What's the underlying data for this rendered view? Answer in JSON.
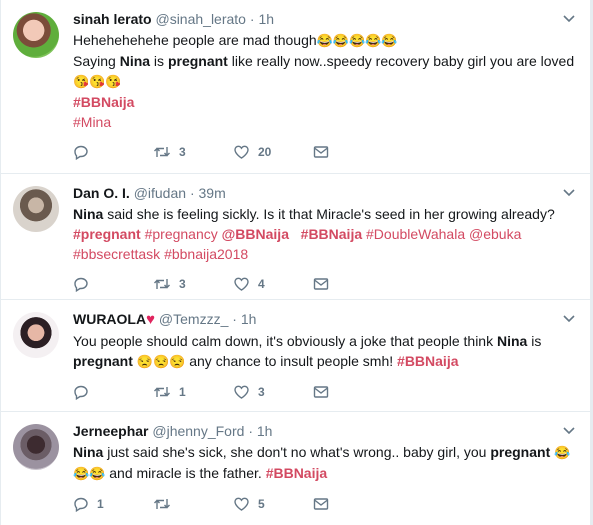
{
  "tweets": [
    {
      "name": "sinah lerato",
      "handle": "@sinah_lerato",
      "dot": "·",
      "time": "1h",
      "line1": "Hehehehehehe people are mad though",
      "line1_emoji": "😂😂😂😂😂",
      "line2_a": "Saying ",
      "line2_b": "Nina",
      "line2_c": " is ",
      "line2_d": "pregnant",
      "line2_e": " like really now..speedy recovery baby girl you are loved",
      "line3_emoji": "😘😘😘",
      "tag1": "#BBNaija",
      "tag2": "#Mina",
      "replies": "",
      "retweets": "3",
      "likes": "20"
    },
    {
      "name": "Dan O. I.",
      "handle": "@ifudan",
      "dot": "·",
      "time": "39m",
      "line1_a": "Nina",
      "line1_b": " said she is feeling sickly. Is it that Miracle's seed in her growing already?",
      "tags_line2": [
        "#pregnant",
        "#pregnancy",
        "@BBNaija",
        "#BBNaija",
        "#DoubleWahala",
        "@ebuka"
      ],
      "tags_line3": [
        "#bbsecrettask",
        "#bbnaija2018"
      ],
      "replies": "",
      "retweets": "3",
      "likes": "4"
    },
    {
      "name": "WURAOLA",
      "heart": "♥",
      "handle": "@Temzzz_",
      "dot": "·",
      "time": "1h",
      "line1_a": "You people should calm down, it's obviously a joke that people think ",
      "line1_b": "Nina",
      "line1_c": " is",
      "line2_a": "pregnant",
      "line2_emoji": "😒😒😒",
      "line2_b": " any chance to insult people smh! ",
      "line2_tag": "#BBNaija",
      "replies": "",
      "retweets": "1",
      "likes": "3"
    },
    {
      "name": "Jerneephar",
      "handle": "@jhenny_Ford",
      "dot": "·",
      "time": "1h",
      "line1_a": "Nina",
      "line1_b": " just said she's sick, she don't no what's wrong..  baby girl, you ",
      "line1_c": "pregnant",
      "line1_emoji": "😂",
      "line2_emoji": "😂😂",
      "line2_a": " and miracle is the father. ",
      "line2_tag": "#BBNaija",
      "replies": "1",
      "retweets": "",
      "likes": "5"
    }
  ],
  "icons": {
    "reply": "reply-icon",
    "retweet": "retweet-icon",
    "like": "like-icon",
    "dm": "message-icon",
    "caret": "chevron-down-icon"
  },
  "colors": {
    "hashtag": "#d34a62",
    "muted": "#657786",
    "heart": "#e0245e"
  }
}
